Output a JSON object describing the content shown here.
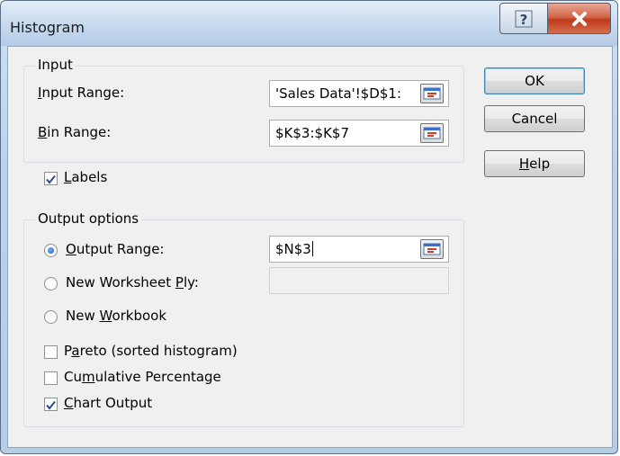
{
  "window": {
    "title": "Histogram"
  },
  "input_group": {
    "legend": "Input",
    "input_range": {
      "label_pre": "",
      "label_key": "I",
      "label_post": "nput Range:",
      "value": "'Sales Data'!$D$1:"
    },
    "bin_range": {
      "label_pre": "",
      "label_key": "B",
      "label_post": "in Range:",
      "value": "$K$3:$K$7"
    }
  },
  "labels_check": {
    "pre": "",
    "key": "L",
    "post": "abels",
    "checked": true
  },
  "output_group": {
    "legend": "Output options",
    "output_range": {
      "pre": "",
      "key": "O",
      "post": "utput Range:",
      "value": "$N$3",
      "selected": true
    },
    "new_worksheet": {
      "pre": "New Worksheet ",
      "key": "P",
      "post": "ly:",
      "value": "",
      "selected": false
    },
    "new_workbook": {
      "pre": "New ",
      "key": "W",
      "post": "orkbook",
      "selected": false
    },
    "pareto": {
      "pre": "P",
      "key": "a",
      "post": "reto (sorted histogram)",
      "checked": false
    },
    "cumulative": {
      "pre": "Cu",
      "key": "m",
      "post": "ulative Percentage",
      "checked": false
    },
    "chart_output": {
      "pre": "",
      "key": "C",
      "post": "hart Output",
      "checked": true
    }
  },
  "buttons": {
    "ok": "OK",
    "cancel": "Cancel",
    "help": {
      "pre": "",
      "key": "H",
      "post": "elp"
    }
  },
  "icons": {
    "help": "question-mark",
    "close": "x-close",
    "refedit": "collapse-dialog"
  }
}
